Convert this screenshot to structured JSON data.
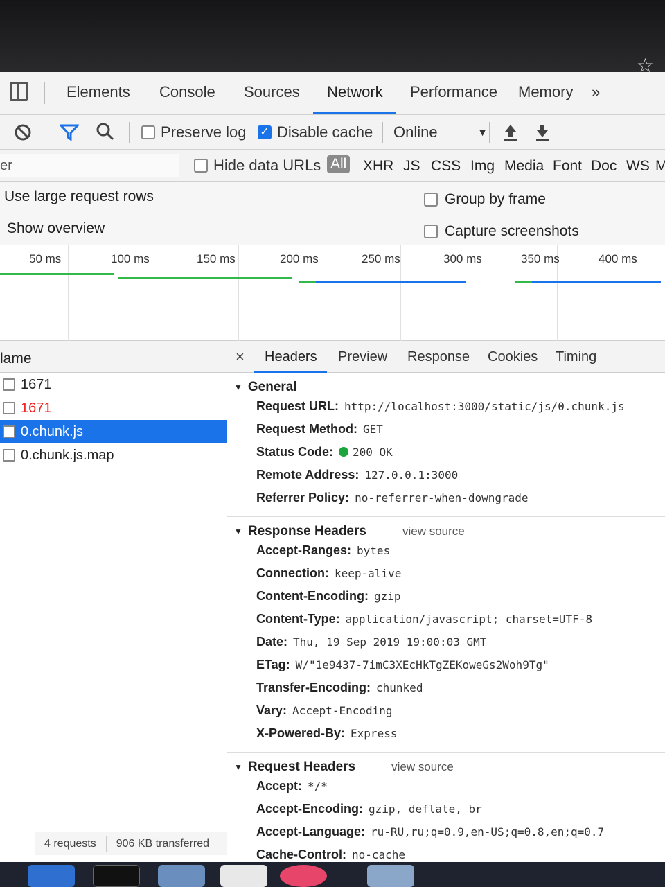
{
  "devtools": {
    "tabs": [
      "Elements",
      "Console",
      "Sources",
      "Network",
      "Performance",
      "Memory"
    ],
    "more_tabs": "»",
    "active_tab": "Network"
  },
  "toolbar": {
    "preserve_log": "Preserve log",
    "disable_cache": "Disable cache",
    "throttle": "Online",
    "throttle_caret": "▼"
  },
  "filter": {
    "input_value": "er",
    "hide_data_urls": "Hide data URLs",
    "types": [
      "All",
      "XHR",
      "JS",
      "CSS",
      "Img",
      "Media",
      "Font",
      "Doc",
      "WS",
      "M"
    ]
  },
  "settings": {
    "large_rows": "Use large request rows",
    "show_overview": "Show overview",
    "group_by_frame": "Group by frame",
    "capture_screenshots": "Capture screenshots"
  },
  "timeline": {
    "ticks": [
      "50 ms",
      "100 ms",
      "150 ms",
      "200 ms",
      "250 ms",
      "300 ms",
      "350 ms",
      "400 ms"
    ]
  },
  "requests": {
    "header": "lame",
    "rows": [
      {
        "name": "1671"
      },
      {
        "name": "1671"
      },
      {
        "name": "0.chunk.js"
      },
      {
        "name": "0.chunk.js.map"
      }
    ],
    "footer_requests": "4 requests",
    "footer_transferred": "906 KB transferred"
  },
  "details": {
    "close": "×",
    "tabs": [
      "Headers",
      "Preview",
      "Response",
      "Cookies",
      "Timing"
    ],
    "general": {
      "title": "General",
      "items": [
        {
          "k": "Request URL:",
          "v": "http://localhost:3000/static/js/0.chunk.js"
        },
        {
          "k": "Request Method:",
          "v": "GET"
        },
        {
          "k": "Status Code:",
          "v": "200 OK"
        },
        {
          "k": "Remote Address:",
          "v": "127.0.0.1:3000"
        },
        {
          "k": "Referrer Policy:",
          "v": "no-referrer-when-downgrade"
        }
      ]
    },
    "response_headers": {
      "title": "Response Headers",
      "view_source": "view source",
      "items": [
        {
          "k": "Accept-Ranges:",
          "v": "bytes"
        },
        {
          "k": "Connection:",
          "v": "keep-alive"
        },
        {
          "k": "Content-Encoding:",
          "v": "gzip"
        },
        {
          "k": "Content-Type:",
          "v": "application/javascript; charset=UTF-8"
        },
        {
          "k": "Date:",
          "v": "Thu, 19 Sep 2019 19:00:03 GMT"
        },
        {
          "k": "ETag:",
          "v": "W/\"1e9437-7imC3XEcHkTgZEKoweGs2Woh9Tg\""
        },
        {
          "k": "Transfer-Encoding:",
          "v": "chunked"
        },
        {
          "k": "Vary:",
          "v": "Accept-Encoding"
        },
        {
          "k": "X-Powered-By:",
          "v": "Express"
        }
      ]
    },
    "request_headers": {
      "title": "Request Headers",
      "view_source": "view source",
      "items": [
        {
          "k": "Accept:",
          "v": "*/*"
        },
        {
          "k": "Accept-Encoding:",
          "v": "gzip, deflate, br"
        },
        {
          "k": "Accept-Language:",
          "v": "ru-RU,ru;q=0.9,en-US;q=0.8,en;q=0.7"
        },
        {
          "k": "Cache-Control:",
          "v": "no-cache"
        }
      ]
    }
  },
  "colors": {
    "accent": "#1a73e8",
    "error": "#e22222",
    "status_ok": "#1ca53a"
  }
}
